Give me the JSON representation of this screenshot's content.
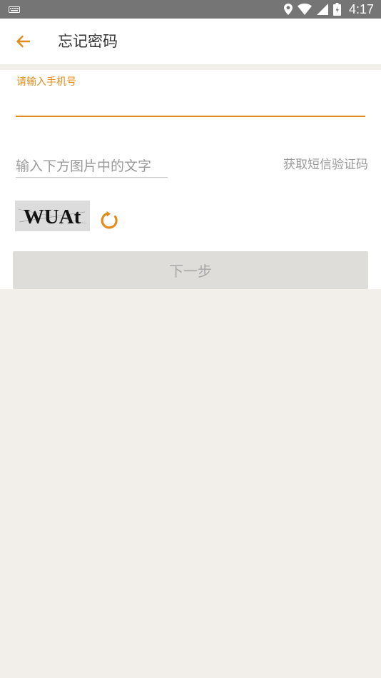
{
  "status_bar": {
    "time": "4:17",
    "icons": [
      "keyboard-icon",
      "location-icon",
      "wifi-icon",
      "signal-icon",
      "battery-icon"
    ]
  },
  "app_bar": {
    "back_icon": "arrow-left-icon",
    "title": "忘记密码"
  },
  "form": {
    "phone_label": "请输入手机号",
    "phone_value": "",
    "captcha_placeholder": "输入下方图片中的文字",
    "sms_button_label": "获取短信验证码",
    "captcha_text": "WUAt",
    "refresh_icon": "refresh-icon",
    "next_button_label": "下一步"
  },
  "colors": {
    "accent": "#e38c1c",
    "status_bar": "#757575",
    "page_background": "#f2efea",
    "disabled_button": "#deddd9"
  }
}
